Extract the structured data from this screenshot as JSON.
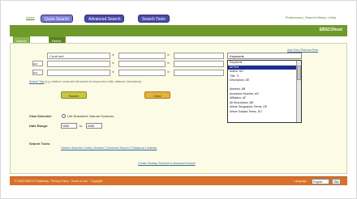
{
  "nav": {
    "home": "Home",
    "tabs": [
      "Quick Search",
      "Advanced Search",
      "Search Tools"
    ],
    "right_links": "Preferences | Search History | Help"
  },
  "header": {
    "title": "EBSCOhost"
  },
  "subtabs": [
    "Search Criteria",
    "Refine Search"
  ],
  "query": {
    "rows": [
      {
        "op": "",
        "value": "Coral reef",
        "field": "in",
        "field_value": ""
      },
      {
        "op": "and",
        "value": "",
        "field": "in",
        "field_value": ""
      },
      {
        "op": "and",
        "value": "",
        "field": "in",
        "field_value": ""
      }
    ],
    "links": "Add Row | Remove Row",
    "field_dropdown": "Keywords",
    "field_options": [
      "Keywords",
      "All Text",
      "Author, AU",
      "Title, TI",
      "Descriptors, DE",
      "",
      "Abstract, AB",
      "Accession Number, AN",
      "Affiliation, AF",
      "All Descriptors, ME",
      "Article Geographic Terms, GE",
      "Article Subject Terms, SU"
    ],
    "hint_prefix": "Search Tips",
    "hint_text": " (e.g. citation* coral reef will search for keywords in title, abstract, descriptors)"
  },
  "buttons": {
    "search": "Search",
    "clear": "Clear"
  },
  "db": {
    "label": "View Selected:",
    "value": "Life Illustrated: Natural Sciences"
  },
  "date": {
    "label": "Date Range:",
    "from": "1900",
    "to_label": "to",
    "to": "2008"
  },
  "tools": {
    "label": "Search Tools:",
    "links": "Citation Searcher | Index | Browse | Combined Search | Thesaurus | Indexes"
  },
  "cbs_link": "Create Desktop Shortcut to Advanced Search",
  "footer": {
    "text": "© 2008 EBSCO Publishing · Privacy Policy · Terms of Use · Copyright",
    "tag": "Language",
    "lang": "English",
    "go": "Go"
  },
  "colors": {
    "band": "#6e9a2c",
    "footer": "#d9702a",
    "tab": "#4a4aa8"
  }
}
